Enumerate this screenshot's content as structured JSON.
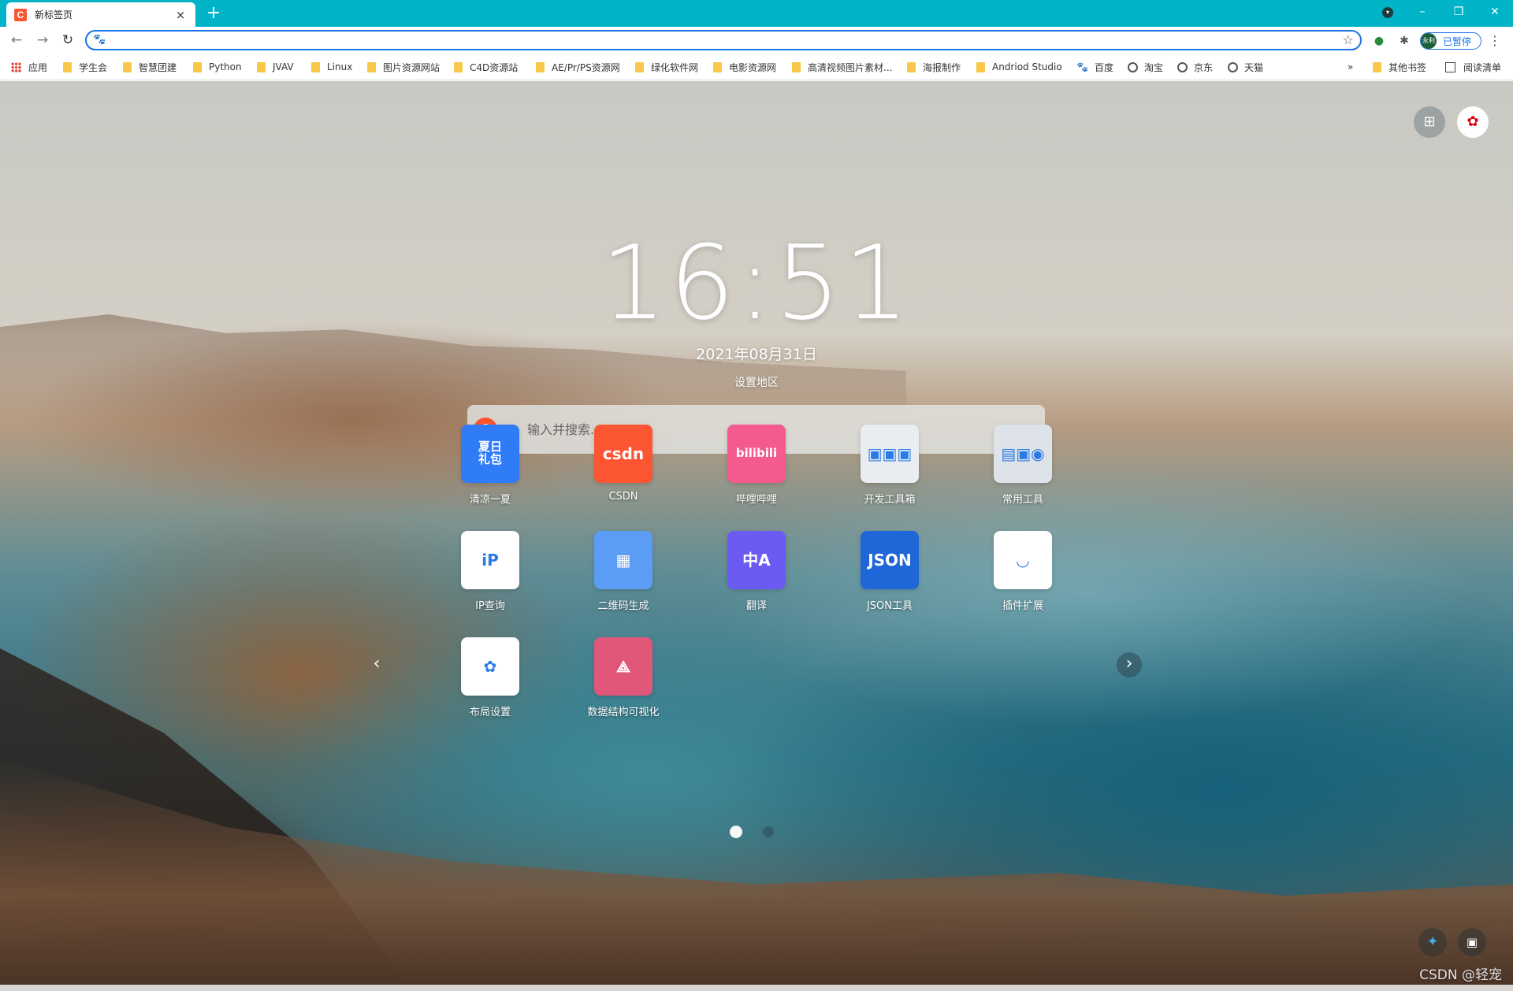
{
  "browser": {
    "tab": {
      "favicon": "C",
      "title": "新标签页",
      "close": "×"
    },
    "new_tab": "+",
    "window_controls": {
      "minimize": "–",
      "restore": "❐",
      "close": "✕"
    },
    "profile_initial": "▾"
  },
  "toolbar": {
    "back": "←",
    "forward": "→",
    "reload": "↻",
    "address_value": "",
    "address_icon": "🐾",
    "star": "☆",
    "extension_icon": "●",
    "puzzle_icon": "✱",
    "profile": {
      "avatar_text": "永利",
      "status": "已暂停"
    },
    "menu": "⋮"
  },
  "bookmarks": {
    "items": [
      {
        "label": "应用",
        "icon": "apps"
      },
      {
        "label": "学生会",
        "icon": "folder"
      },
      {
        "label": "智慧团建",
        "icon": "folder"
      },
      {
        "label": "Python",
        "icon": "folder"
      },
      {
        "label": "JVAV",
        "icon": "folder"
      },
      {
        "label": "Linux",
        "icon": "folder"
      },
      {
        "label": "图片资源网站",
        "icon": "folder"
      },
      {
        "label": "C4D资源站",
        "icon": "folder"
      },
      {
        "label": "AE/Pr/PS资源网",
        "icon": "folder"
      },
      {
        "label": "绿化软件网",
        "icon": "folder"
      },
      {
        "label": "电影资源网",
        "icon": "folder"
      },
      {
        "label": "高清视频图片素材...",
        "icon": "folder"
      },
      {
        "label": "海报制作",
        "icon": "folder"
      },
      {
        "label": "Andriod Studio",
        "icon": "folder"
      },
      {
        "label": "百度",
        "icon": "paw"
      },
      {
        "label": "淘宝",
        "icon": "globe"
      },
      {
        "label": "京东",
        "icon": "globe"
      },
      {
        "label": "天猫",
        "icon": "globe"
      }
    ],
    "overflow": "»",
    "other": "其他书签",
    "reading_list": "阅读清单"
  },
  "newtab": {
    "time": "16:51",
    "date": "2021年08月31日",
    "region": "设置地区",
    "search": {
      "engine_letter": "C",
      "placeholder": "输入并搜索..."
    },
    "apps": [
      {
        "label": "清凉一夏",
        "icon_text": "夏日\n礼包",
        "color": "#2f7cf6"
      },
      {
        "label": "CSDN",
        "icon_text": "csdn",
        "color": "#fc5531"
      },
      {
        "label": "哔哩哔哩",
        "icon_text": "bilibili",
        "color": "#f45a8d"
      },
      {
        "label": "开发工具箱",
        "icon_text": "▣▣▣",
        "color": "#e9edf2"
      },
      {
        "label": "常用工具",
        "icon_text": "▤▣◉",
        "color": "#dde3e8"
      },
      {
        "label": "IP查询",
        "icon_text": "iP",
        "color": "#ffffff"
      },
      {
        "label": "二维码生成",
        "icon_text": "▦",
        "color": "#5b9cf4"
      },
      {
        "label": "翻译",
        "icon_text": "中A",
        "color": "#6b5bf2"
      },
      {
        "label": "JSON工具",
        "icon_text": "JSON",
        "color": "#1f67d8"
      },
      {
        "label": "插件扩展",
        "icon_text": "◡",
        "color": "#ffffff"
      },
      {
        "label": "布局设置",
        "icon_text": "✿",
        "color": "#ffffff"
      },
      {
        "label": "数据结构可视化",
        "icon_text": "⟁",
        "color": "#e0577a"
      }
    ],
    "prev": "‹",
    "next": "›",
    "page_count": 2,
    "current_page": 1
  },
  "watermark": "CSDN @轻宠"
}
